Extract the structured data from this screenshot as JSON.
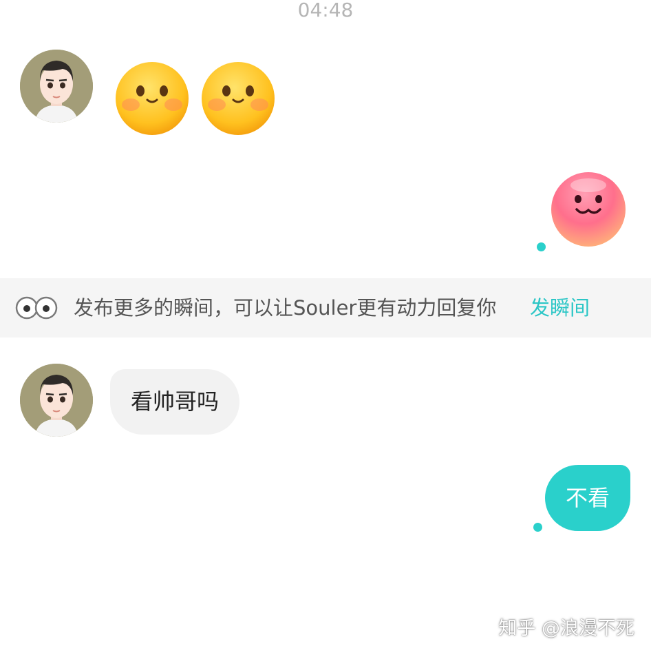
{
  "timestamp": "04:48",
  "tip_bar": {
    "text": "发布更多的瞬间，可以让Souler更有动力回复你",
    "link": "发瞬间",
    "eyes_icon": "eyes-icon"
  },
  "messages": [
    {
      "side": "incoming",
      "type": "emoji",
      "emoji": "shy-smile-emoji",
      "count": 2
    },
    {
      "side": "outgoing",
      "type": "emoji",
      "emoji": "blush-pink-emoji"
    },
    {
      "side": "incoming",
      "type": "text",
      "text": "看帅哥吗"
    },
    {
      "side": "outgoing",
      "type": "text",
      "text": "不看"
    }
  ],
  "watermark": "知乎 @浪漫不死",
  "colors": {
    "accent": "#2ad0cb",
    "link": "#2bc6c6",
    "incoming_bubble": "#f2f2f2",
    "avatar_bg": "#a39d78"
  }
}
